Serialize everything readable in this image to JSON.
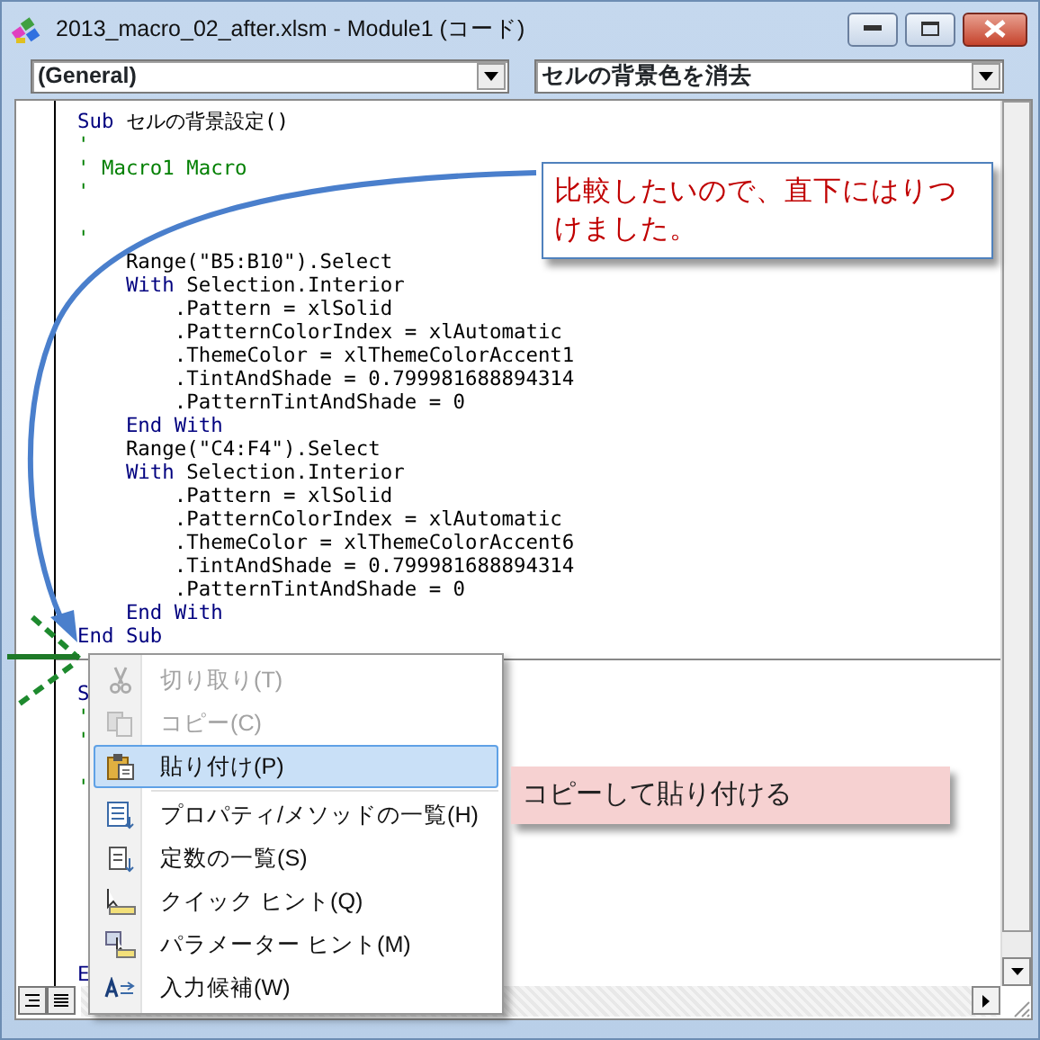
{
  "window": {
    "title": "2013_macro_02_after.xlsm - Module1 (コード)"
  },
  "procedure_boxes": [
    {
      "value": "(General)"
    },
    {
      "value": "セルの背景色を消去"
    }
  ],
  "procedures": [
    {
      "lines": [
        {
          "kind": "code",
          "spans": [
            {
              "text": "Sub",
              "kind": "keyword"
            },
            {
              "text": " セルの背景設定()",
              "kind": "plain"
            }
          ]
        },
        {
          "kind": "code",
          "spans": [
            {
              "text": "'",
              "kind": "comment"
            }
          ]
        },
        {
          "kind": "code",
          "spans": [
            {
              "text": "' Macro1 Macro",
              "kind": "comment"
            }
          ]
        },
        {
          "kind": "code",
          "spans": [
            {
              "text": "'",
              "kind": "comment"
            }
          ]
        },
        {
          "kind": "blank"
        },
        {
          "kind": "code",
          "spans": [
            {
              "text": "'",
              "kind": "comment"
            }
          ]
        },
        {
          "kind": "code",
          "spans": [
            {
              "text": "    Range(\"B5:B10\").Select",
              "kind": "plain"
            }
          ]
        },
        {
          "kind": "code",
          "spans": [
            {
              "text": "    With",
              "kind": "keyword"
            },
            {
              "text": " Selection.Interior",
              "kind": "plain"
            }
          ]
        },
        {
          "kind": "code",
          "spans": [
            {
              "text": "        .Pattern = xlSolid",
              "kind": "plain"
            }
          ]
        },
        {
          "kind": "code",
          "spans": [
            {
              "text": "        .PatternColorIndex = xlAutomatic",
              "kind": "plain"
            }
          ]
        },
        {
          "kind": "code",
          "spans": [
            {
              "text": "        .ThemeColor = xlThemeColorAccent1",
              "kind": "plain"
            }
          ]
        },
        {
          "kind": "code",
          "spans": [
            {
              "text": "        .TintAndShade = 0.799981688894314",
              "kind": "plain"
            }
          ]
        },
        {
          "kind": "code",
          "spans": [
            {
              "text": "        .PatternTintAndShade = 0",
              "kind": "plain"
            }
          ]
        },
        {
          "kind": "code",
          "spans": [
            {
              "text": "    End With",
              "kind": "keyword"
            }
          ]
        },
        {
          "kind": "code",
          "spans": [
            {
              "text": "    Range(\"C4:F4\").Select",
              "kind": "plain"
            }
          ]
        },
        {
          "kind": "code",
          "spans": [
            {
              "text": "    With",
              "kind": "keyword"
            },
            {
              "text": " Selection.Interior",
              "kind": "plain"
            }
          ]
        },
        {
          "kind": "code",
          "spans": [
            {
              "text": "        .Pattern = xlSolid",
              "kind": "plain"
            }
          ]
        },
        {
          "kind": "code",
          "spans": [
            {
              "text": "        .PatternColorIndex = xlAutomatic",
              "kind": "plain"
            }
          ]
        },
        {
          "kind": "code",
          "spans": [
            {
              "text": "        .ThemeColor = xlThemeColorAccent6",
              "kind": "plain"
            }
          ]
        },
        {
          "kind": "code",
          "spans": [
            {
              "text": "        .TintAndShade = 0.799981688894314",
              "kind": "plain"
            }
          ]
        },
        {
          "kind": "code",
          "spans": [
            {
              "text": "        .PatternTintAndShade = 0",
              "kind": "plain"
            }
          ]
        },
        {
          "kind": "code",
          "spans": [
            {
              "text": "    End With",
              "kind": "keyword"
            }
          ]
        },
        {
          "kind": "code",
          "spans": [
            {
              "text": "End Sub",
              "kind": "keyword"
            }
          ]
        }
      ]
    },
    {
      "lines": [
        {
          "kind": "code",
          "spans": [
            {
              "text": "S",
              "kind": "keyword"
            }
          ]
        },
        {
          "kind": "code",
          "spans": [
            {
              "text": "'",
              "kind": "comment"
            }
          ]
        },
        {
          "kind": "code",
          "spans": [
            {
              "text": "'",
              "kind": "comment"
            }
          ]
        },
        {
          "kind": "blank"
        },
        {
          "kind": "code",
          "spans": [
            {
              "text": "'",
              "kind": "comment"
            }
          ]
        },
        {
          "kind": "blank"
        },
        {
          "kind": "blank"
        },
        {
          "kind": "blank"
        },
        {
          "kind": "blank"
        },
        {
          "kind": "blank"
        },
        {
          "kind": "blank"
        },
        {
          "kind": "blank"
        },
        {
          "kind": "code",
          "spans": [
            {
              "text": "E",
              "kind": "keyword"
            }
          ]
        }
      ]
    }
  ],
  "context_menu": [
    {
      "kind": "item",
      "label": "切り取り(T)",
      "disabled": true,
      "selected": false,
      "submenu": false
    },
    {
      "kind": "item",
      "label": "コピー(C)",
      "disabled": true,
      "selected": false,
      "submenu": false
    },
    {
      "kind": "item",
      "label": "貼り付け(P)",
      "disabled": false,
      "selected": true,
      "submenu": false
    },
    {
      "kind": "separator"
    },
    {
      "kind": "item",
      "label": "プロパティ/メソッドの一覧(H)",
      "disabled": false,
      "selected": false,
      "submenu": false
    },
    {
      "kind": "item",
      "label": "定数の一覧(S)",
      "disabled": false,
      "selected": false,
      "submenu": false
    },
    {
      "kind": "item",
      "label": "クイック ヒント(Q)",
      "disabled": false,
      "selected": false,
      "submenu": false
    },
    {
      "kind": "item",
      "label": "パラメーター ヒント(M)",
      "disabled": false,
      "selected": false,
      "submenu": false
    },
    {
      "kind": "item",
      "label": "入力候補(W)",
      "disabled": false,
      "selected": false,
      "submenu": false
    }
  ],
  "callouts": [
    {
      "kind": "outlined",
      "text": "比較したいので、直下にはりつけました。"
    },
    {
      "kind": "filled",
      "text": "コピーして貼り付ける"
    }
  ]
}
